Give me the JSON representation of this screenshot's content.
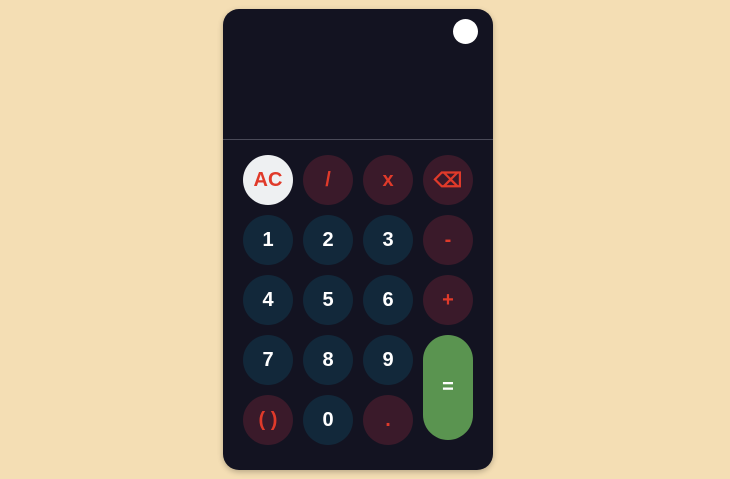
{
  "display": {
    "expression": "",
    "result": ""
  },
  "keypad": {
    "ac": "AC",
    "divide": "/",
    "multiply": "x",
    "backspace": "⌫",
    "one": "1",
    "two": "2",
    "three": "3",
    "minus": "-",
    "four": "4",
    "five": "5",
    "six": "6",
    "plus": "+",
    "seven": "7",
    "eight": "8",
    "nine": "9",
    "equals": "=",
    "parens": "( )",
    "zero": "0",
    "decimal": "."
  },
  "colors": {
    "page_background": "#f4deb4",
    "calculator_body": "#131321",
    "number_key": "#12283a",
    "operator_key": "#3a1a2a",
    "operator_text": "#e03a2a",
    "clear_key": "#eef0f2",
    "equals_key": "#5a9450"
  }
}
